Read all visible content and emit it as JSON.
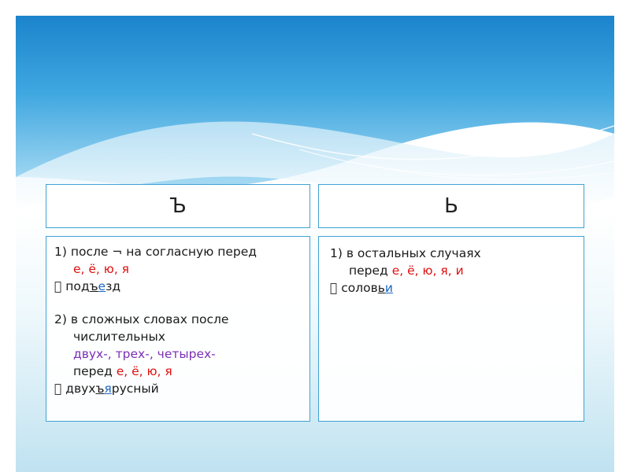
{
  "headers": {
    "left": "Ъ",
    "right": "Ь"
  },
  "left": {
    "r1_num": "1)",
    "r1_text": "после ¬ на согласную перед",
    "r1_letters": "е, ё, ю, я",
    "ex1_bullet": "",
    "ex1_a": "под",
    "ex1_b": "ъ",
    "ex1_c": "е",
    "ex1_d": "зд",
    "r2_text": "2) в сложных словах после",
    "r2_cont": "числительных",
    "r2_nums": "двух-, трех-, четырех-",
    "r2_before": "перед ",
    "r2_letters": "е, ё, ю, я",
    "ex2_bullet": "",
    "ex2_a": "двух",
    "ex2_b": "ъ",
    "ex2_c": "я",
    "ex2_d": "русный"
  },
  "right": {
    "r1_text": "1) в остальных случаях",
    "r1_before": "перед ",
    "r1_letters": "е, ё, ю, я, и",
    "ex_bullet": "",
    "ex_a": "солов",
    "ex_b": "ь",
    "ex_c": "и"
  }
}
